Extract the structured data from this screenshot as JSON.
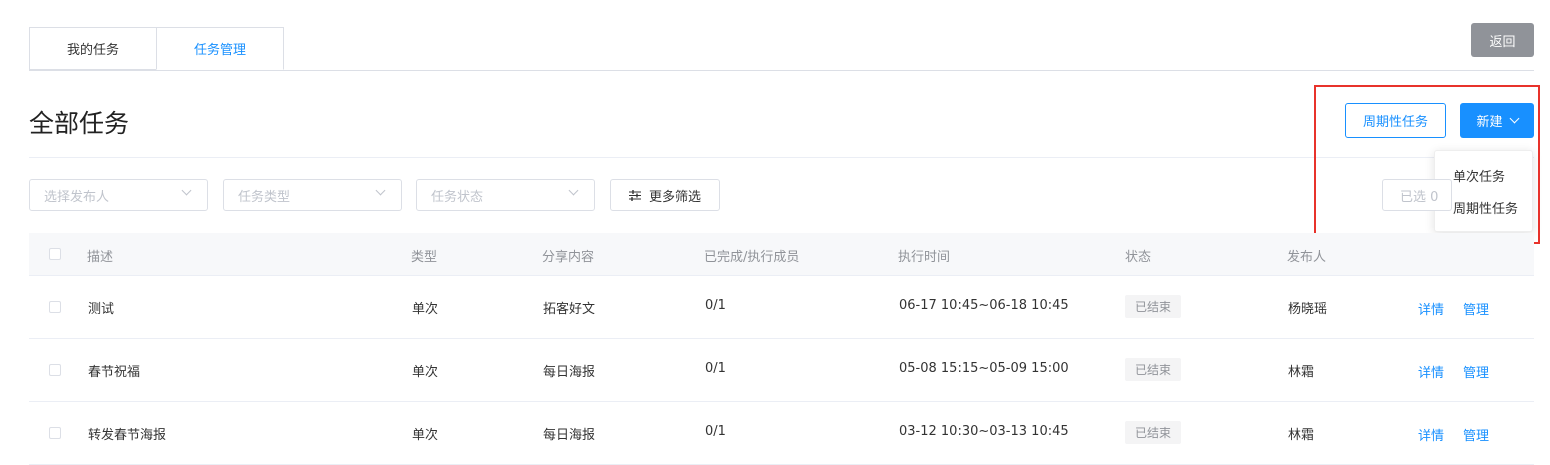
{
  "tabs": [
    {
      "label": "我的任务",
      "active": false
    },
    {
      "label": "任务管理",
      "active": true
    }
  ],
  "back_button": "返回",
  "page_title": "全部任务",
  "actions": {
    "periodic_button": "周期性任务",
    "new_button": "新建",
    "new_menu": [
      "单次任务",
      "周期性任务"
    ]
  },
  "filters": {
    "publisher_placeholder": "选择发布人",
    "type_placeholder": "任务类型",
    "status_placeholder": "任务状态",
    "more_filters": "更多筛选",
    "selected_label": "已选 0"
  },
  "table": {
    "headers": [
      "描述",
      "类型",
      "分享内容",
      "已完成/执行成员",
      "执行时间",
      "状态",
      "发布人"
    ],
    "rows": [
      {
        "desc": "测试",
        "type": "单次",
        "content": "拓客好文",
        "progress": "0/1",
        "time": "06-17 10:45~06-18 10:45",
        "status": "已结束",
        "publisher": "杨晓瑶",
        "detail": "详情",
        "manage": "管理"
      },
      {
        "desc": "春节祝福",
        "type": "单次",
        "content": "每日海报",
        "progress": "0/1",
        "time": "05-08 15:15~05-09 15:00",
        "status": "已结束",
        "publisher": "林霜",
        "detail": "详情",
        "manage": "管理"
      },
      {
        "desc": "转发春节海报",
        "type": "单次",
        "content": "每日海报",
        "progress": "0/1",
        "time": "03-12 10:30~03-13 10:45",
        "status": "已结束",
        "publisher": "林霜",
        "detail": "详情",
        "manage": "管理"
      }
    ]
  },
  "colors": {
    "accent": "#1890ff",
    "highlight": "#e8322b",
    "back_button": "#909399"
  }
}
